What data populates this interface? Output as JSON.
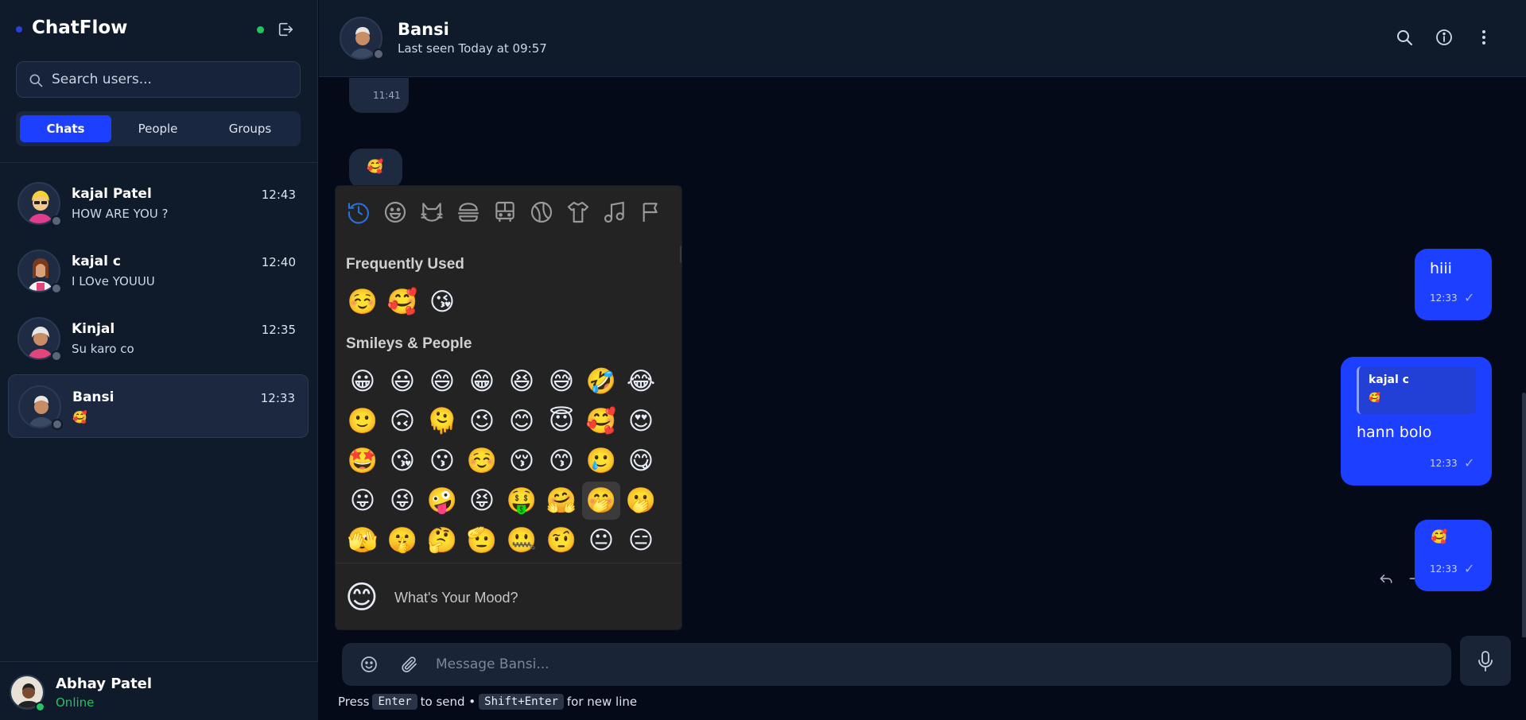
{
  "app": {
    "brand": "ChatFlow"
  },
  "search": {
    "placeholder": "Search users..."
  },
  "tabs": [
    {
      "label": "Chats",
      "active": true
    },
    {
      "label": "People",
      "active": false
    },
    {
      "label": "Groups",
      "active": false
    }
  ],
  "chats": [
    {
      "name": "kajal Patel",
      "time": "12:43",
      "preview": "HOW ARE YOU ?"
    },
    {
      "name": "kajal c",
      "time": "12:40",
      "preview": "I LOve YOUUU"
    },
    {
      "name": "Kinjal",
      "time": "12:35",
      "preview": "Su karo co"
    },
    {
      "name": "Bansi",
      "time": "12:33",
      "preview": "🥰",
      "selected": true
    }
  ],
  "current_user": {
    "name": "Abhay Patel",
    "status": "Online"
  },
  "header": {
    "name": "Bansi",
    "status": "Last seen Today at 09:57"
  },
  "messages": {
    "incoming_top_time": "11:41",
    "incoming_emoji": "🥰",
    "out1": {
      "text": "hiii",
      "time": "12:33",
      "check": "✓"
    },
    "out2": {
      "quote_name": "kajal c",
      "quote_text": "🥰",
      "text": "hann bolo",
      "time": "12:33",
      "check": "✓"
    },
    "out3": {
      "text": "🥰",
      "time": "12:33",
      "check": "✓"
    }
  },
  "emoji_picker": {
    "frequently_used_title": "Frequently Used",
    "frequently_used": [
      "☺️",
      "🥰",
      "😘"
    ],
    "smileys_title": "Smileys & People",
    "smileys": [
      "😀",
      "😃",
      "😄",
      "😁",
      "😆",
      "😅",
      "🤣",
      "😂",
      "🙂",
      "🙃",
      "🫠",
      "😉",
      "😊",
      "😇",
      "🥰",
      "😍",
      "🤩",
      "😘",
      "😗",
      "☺️",
      "😚",
      "😙",
      "🥲",
      "😋",
      "😛",
      "😜",
      "🤪",
      "😝",
      "🤑",
      "🤗",
      "🤭",
      "🫢",
      "🫣",
      "🤫",
      "🤔",
      "🫡",
      "🤐",
      "🤨",
      "😐",
      "😑"
    ],
    "mood_emoji": "😊",
    "mood_text": "What's Your Mood?"
  },
  "composer": {
    "placeholder": "Message Bansi...",
    "hint_press": "Press",
    "hint_key1": "Enter",
    "hint_mid": "to send •",
    "hint_key2": "Shift+Enter",
    "hint_end": "for new line"
  },
  "colors": {
    "accent": "#1d3fff",
    "online": "#22c55e",
    "sidebar_bg": "#0f1a2b",
    "chat_bg": "#040a18"
  }
}
